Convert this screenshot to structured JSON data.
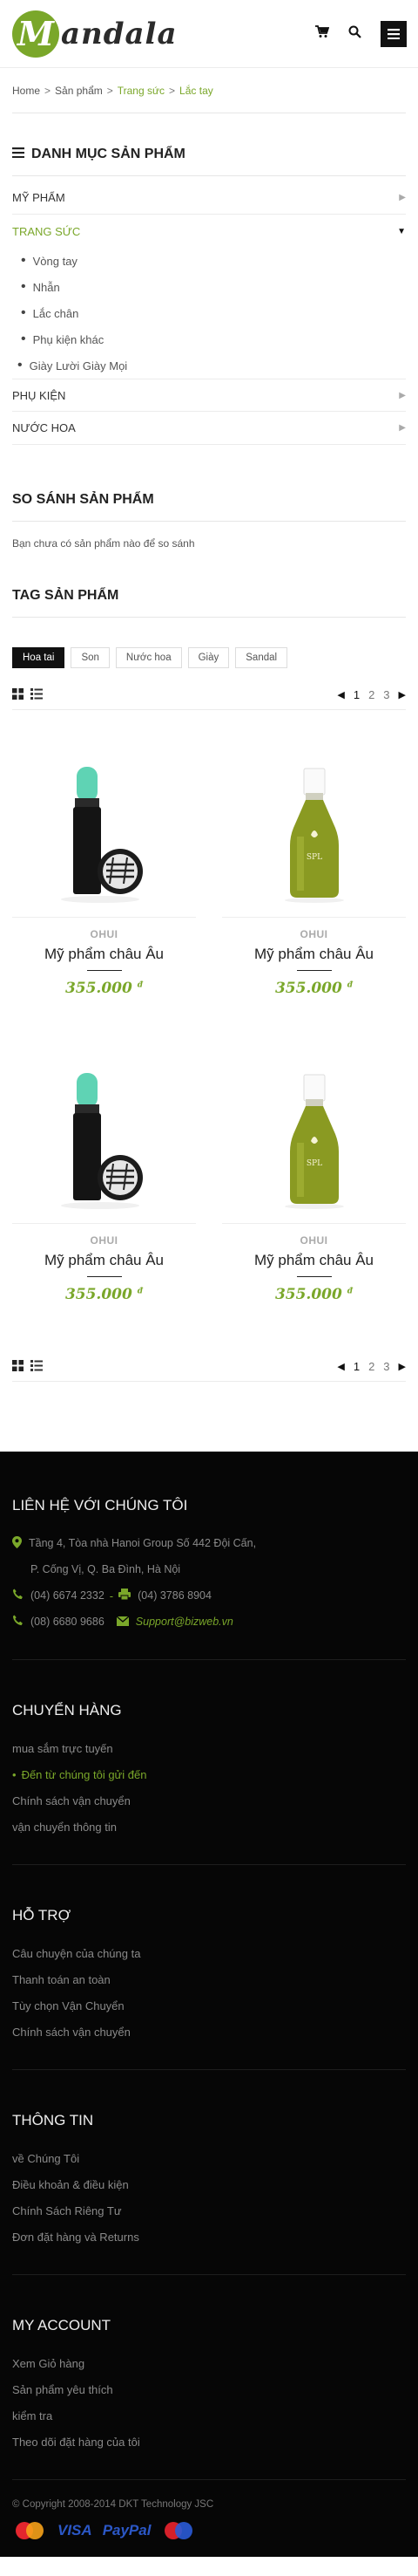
{
  "header": {
    "logo_letter": "M",
    "logo_rest": "andala"
  },
  "breadcrumb": [
    "Home",
    "Sản phẩm",
    "Trang sức",
    "Lắc tay"
  ],
  "categories": {
    "title": "DANH MỤC SẢN PHẨM",
    "items": [
      {
        "label": "MỸ PHẨM"
      },
      {
        "label": "TRANG SỨC"
      },
      {
        "label": "PHỤ KIỆN"
      },
      {
        "label": "NƯỚC HOA"
      }
    ],
    "sub": [
      "Vòng tay",
      "Nhẫn",
      "Lắc chân",
      "Phụ kiện khác",
      "Giày Lười Giày Mọi"
    ]
  },
  "compare": {
    "title": "SO SÁNH SẢN PHẨM",
    "text": "Bạn chưa có sản phẩm nào để so sánh"
  },
  "tags": {
    "title": "TAG SẢN PHẨM",
    "items": [
      "Hoa tai",
      "Son",
      "Nước hoa",
      "Giày",
      "Sandal"
    ]
  },
  "pager": {
    "pages": [
      "1",
      "2",
      "3"
    ]
  },
  "products": [
    {
      "brand": "OHUI",
      "name": "Mỹ phẩm châu Âu",
      "price": "355.000",
      "cur": "đ"
    },
    {
      "brand": "OHUI",
      "name": "Mỹ phẩm châu Âu",
      "price": "355.000",
      "cur": "đ"
    },
    {
      "brand": "OHUI",
      "name": "Mỹ phẩm châu Âu",
      "price": "355.000",
      "cur": "đ"
    },
    {
      "brand": "OHUI",
      "name": "Mỹ phẩm châu Âu",
      "price": "355.000",
      "cur": "đ"
    }
  ],
  "footer": {
    "contact": {
      "title": "LIÊN HỆ VỚI CHÚNG TÔI",
      "addr1": "Tầng 4, Tòa nhà Hanoi Group  Số 442 Đội Cấn,",
      "addr2": "P. Cống Vị, Q. Ba Đình, Hà Nội",
      "phone1": "(04) 6674 2332",
      "phone2": "(04) 3786 8904",
      "phone3": "(08) 6680 9686",
      "email": "Support@bizweb.vn"
    },
    "ship": {
      "title": "CHUYỂN HÀNG",
      "items": [
        "mua sắm trực tuyến",
        "Đến từ chúng tôi gửi đến",
        "Chính sách vận chuyển",
        "vận chuyển thông tin"
      ]
    },
    "support": {
      "title": "HỖ TRỢ",
      "items": [
        "Câu chuyện của chúng ta",
        "Thanh toán an toàn",
        "Tùy chọn Vận Chuyển",
        "Chính sách vận chuyển"
      ]
    },
    "info": {
      "title": "THÔNG TIN",
      "items": [
        "về Chúng Tôi",
        "Điều khoản & điều kiện",
        "Chính Sách Riêng Tư",
        "Đơn đặt hàng và Returns"
      ]
    },
    "account": {
      "title": "MY ACCOUNT",
      "items": [
        "Xem Giỏ hàng",
        "Sản phẩm yêu thích",
        "kiểm tra",
        "Theo dõi đặt hàng của tôi"
      ]
    },
    "copyright": "© Copyright 2008-2014 DKT Technology JSC",
    "payments": [
      "VISA",
      "PayPal"
    ]
  },
  "colors": {
    "accent": "#7aa72a",
    "footer_bg": "#060606"
  }
}
